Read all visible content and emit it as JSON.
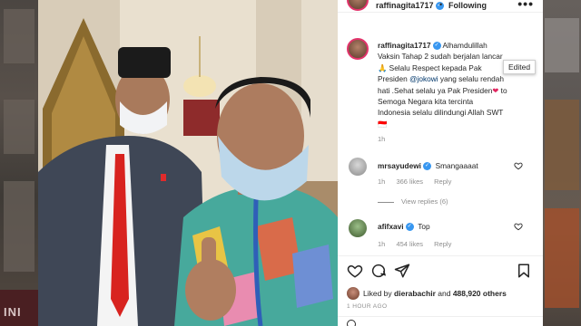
{
  "post": {
    "username": "raffinagita1717",
    "follow_status": "Following",
    "separator": "•",
    "more": "•••"
  },
  "caption": {
    "username": "raffinagita1717",
    "line1": "Alhamdulillah",
    "line2": "Vaksin Tahap 2 sudah berjalan lancar",
    "line3_emoji": "🙏",
    "line3": "Selalu Respect kepada Pak",
    "line4": "Presiden",
    "mention": "@jokowi",
    "line4_rest": "yang selalu rendah",
    "line5": "hati .Sehat selalu ya Pak Presiden",
    "heart": "❤",
    "line5_rest": "to",
    "line6": "Semoga Negara kita tercinta",
    "line7": "Indonesia selalu dilindungi Allah SWT",
    "flag": "🇮🇩",
    "time": "1h"
  },
  "tooltip": {
    "label": "Edited"
  },
  "comments": [
    {
      "username": "mrsayudewi",
      "text": "Smangaaaat",
      "time": "1h",
      "likes": "366 likes",
      "reply": "Reply"
    },
    {
      "username": "afifxavi",
      "text": "Top",
      "time": "1h",
      "likes": "454 likes",
      "reply": "Reply"
    }
  ],
  "view_replies": "View replies (6)",
  "likes_summary": {
    "prefix": "Liked by",
    "user": "dierabachir",
    "and": "and",
    "count": "488,920 others"
  },
  "time_ago": "1 HOUR AGO",
  "background": {
    "left_text": "INI"
  },
  "colors": {
    "verified": "#3897f0",
    "story_ring": "#e2336b",
    "secondary_text": "#8e8e8e"
  }
}
